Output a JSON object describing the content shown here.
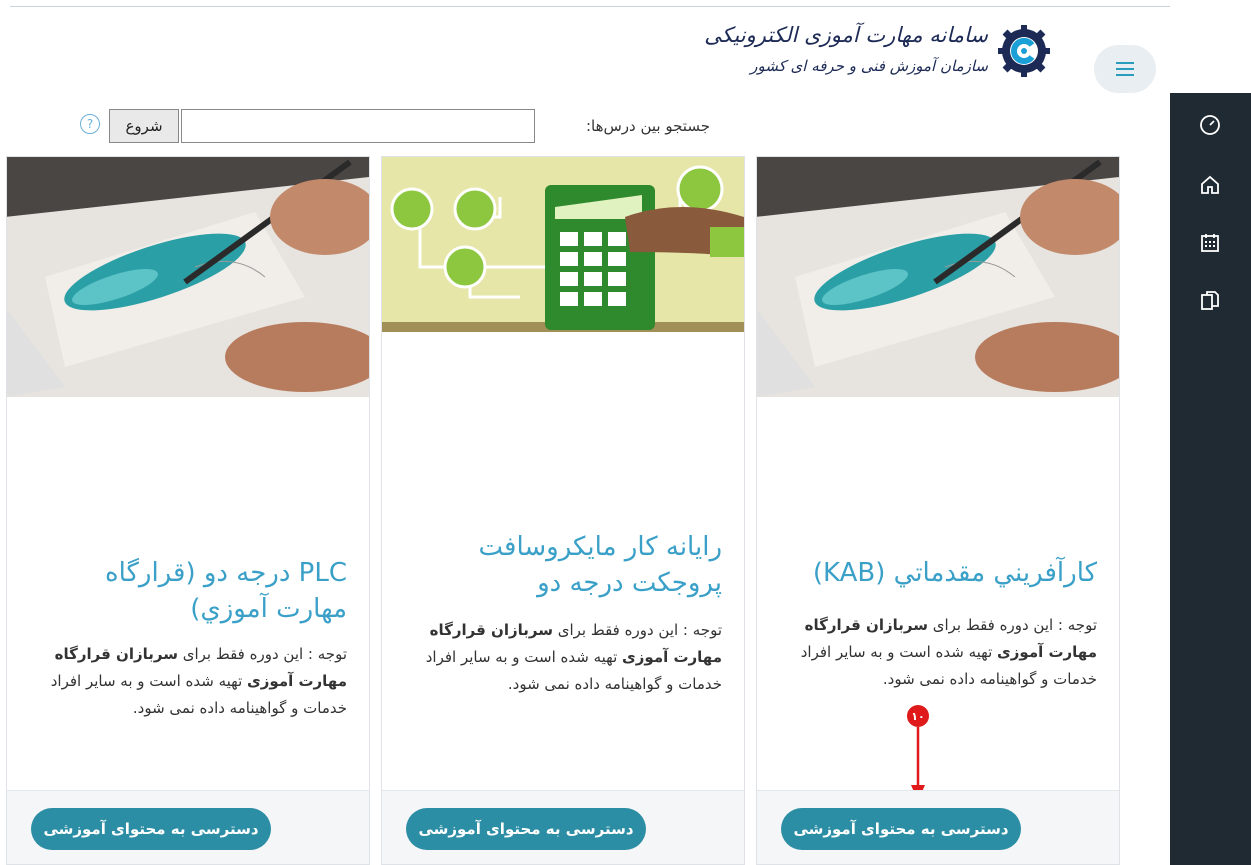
{
  "header": {
    "logo_line1": "سامانه مهارت آموزی الکترونیکی",
    "logo_line2": "سازمان آموزش فنی و حرفه ای کشور",
    "menu_icon": "hamburger-icon"
  },
  "sidebar": {
    "items": [
      {
        "icon": "dashboard-icon"
      },
      {
        "icon": "home-icon"
      },
      {
        "icon": "calendar-icon"
      },
      {
        "icon": "documents-icon"
      }
    ]
  },
  "search": {
    "label": "جستجو بین درس‌ها:",
    "value": "",
    "button_label": "شروع",
    "help": "?"
  },
  "courses": [
    {
      "title": "کارآفريني مقدماتي (KAB)",
      "note_prefix": "توجه : این دوره فقط برای ",
      "note_bold": "سربازان قرارگاه مهارت آموزی",
      "note_suffix": " تهیه شده است و به سایر افراد خدمات و گواهینامه داده نمی شود.",
      "button": "دسترسی به محتوای آموزشی",
      "image": "painting"
    },
    {
      "title": "رایانه کار مایکروسافت پروجکت درجه دو",
      "note_prefix": "توجه : این دوره فقط برای ",
      "note_bold": "سربازان قرارگاه مهارت آموزی",
      "note_suffix": " تهیه شده است و به سایر افراد خدمات و گواهینامه داده نمی شود.",
      "button": "دسترسی به محتوای آموزشی",
      "image": "calculator"
    },
    {
      "title": "PLC درجه دو (قرارگاه مهارت آموزي)",
      "note_prefix": "توجه : این دوره فقط برای ",
      "note_bold": "سربازان قرارگاه مهارت آموزی",
      "note_suffix": " تهیه شده است و به سایر افراد خدمات و گواهینامه داده نمی شود.",
      "button": "دسترسی به محتوای آموزشی",
      "image": "painting"
    }
  ],
  "annotation": {
    "badge": "۱۰",
    "color": "#e01a1a"
  },
  "colors": {
    "accent": "#2c8ea5",
    "title": "#3aa0c8",
    "sidebar": "#1f2a33"
  }
}
